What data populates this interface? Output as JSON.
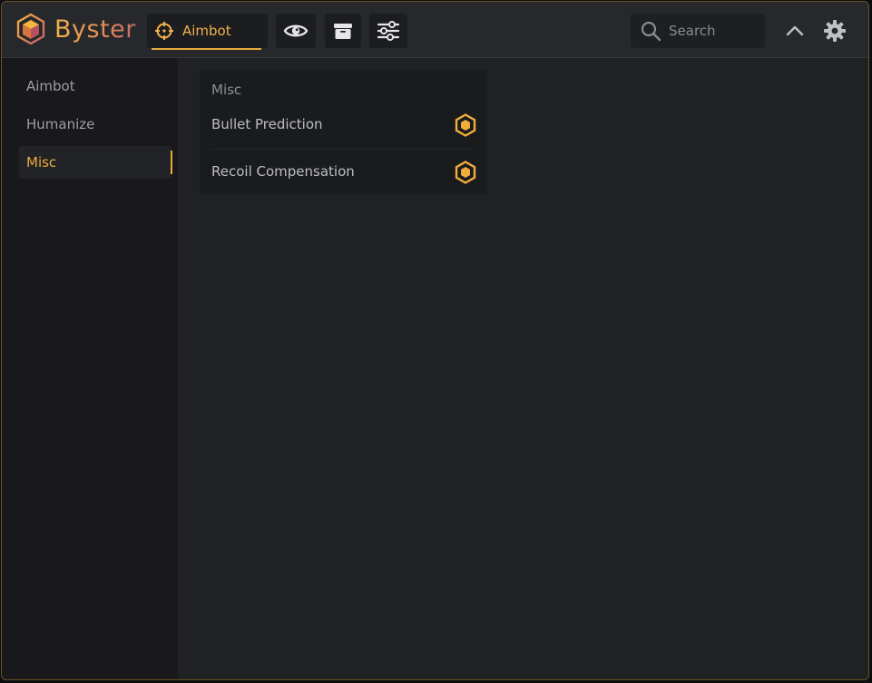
{
  "app": {
    "name": "Byster"
  },
  "header": {
    "tabs": [
      {
        "label": "Aimbot",
        "icon": "crosshair-icon",
        "active": true
      },
      {
        "label": "",
        "icon": "eye-icon",
        "active": false
      },
      {
        "label": "",
        "icon": "box-icon",
        "active": false
      },
      {
        "label": "",
        "icon": "sliders-icon",
        "active": false
      }
    ],
    "search": {
      "placeholder": "Search",
      "value": ""
    }
  },
  "sidebar": {
    "items": [
      {
        "label": "Aimbot",
        "active": false
      },
      {
        "label": "Humanize",
        "active": false
      },
      {
        "label": "Misc",
        "active": true
      }
    ]
  },
  "panel": {
    "title": "Misc",
    "options": [
      {
        "label": "Bullet Prediction",
        "enabled": true
      },
      {
        "label": "Recoil Compensation",
        "enabled": true
      }
    ]
  },
  "colors": {
    "accent": "#EFAA3D",
    "background": "#202123",
    "sidebar": "#19191B",
    "header": "#27282B"
  }
}
